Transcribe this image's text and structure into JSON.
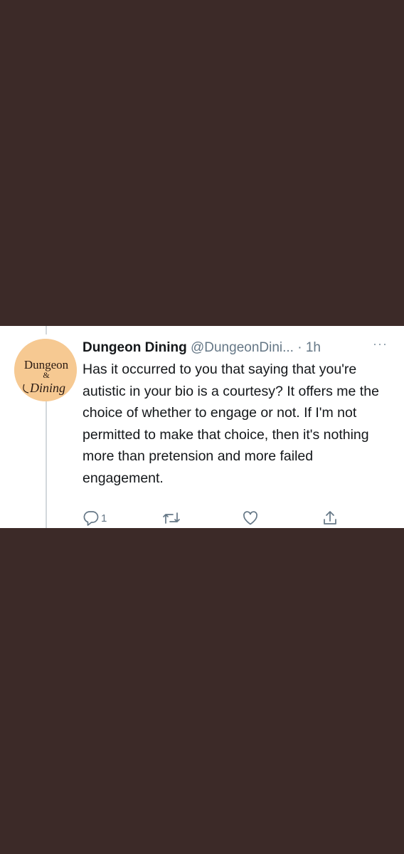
{
  "tweet": {
    "display_name": "Dungeon Dining",
    "handle": "@DungeonDini...",
    "separator": "·",
    "time": "1h",
    "more": "···",
    "text": "Has it occurred to you that saying that you're autistic in your bio is a courtesy? It offers me the choice of whether to engage or not. If I'm not permitted to make that choice, then it's nothing more than pretension and more failed engagement.",
    "avatar": {
      "line1": "Dungeon",
      "line2": "&",
      "line3": "Dining",
      "background": "#f6c992"
    }
  },
  "actions": {
    "reply": {
      "icon": "reply-icon",
      "count": "1"
    },
    "retweet": {
      "icon": "retweet-icon"
    },
    "like": {
      "icon": "heart-icon"
    },
    "share": {
      "icon": "share-icon"
    }
  },
  "colors": {
    "background": "#3c2a28",
    "card": "#ffffff",
    "text": "#14171a",
    "secondary": "#657786",
    "icon": "#8899a6"
  }
}
